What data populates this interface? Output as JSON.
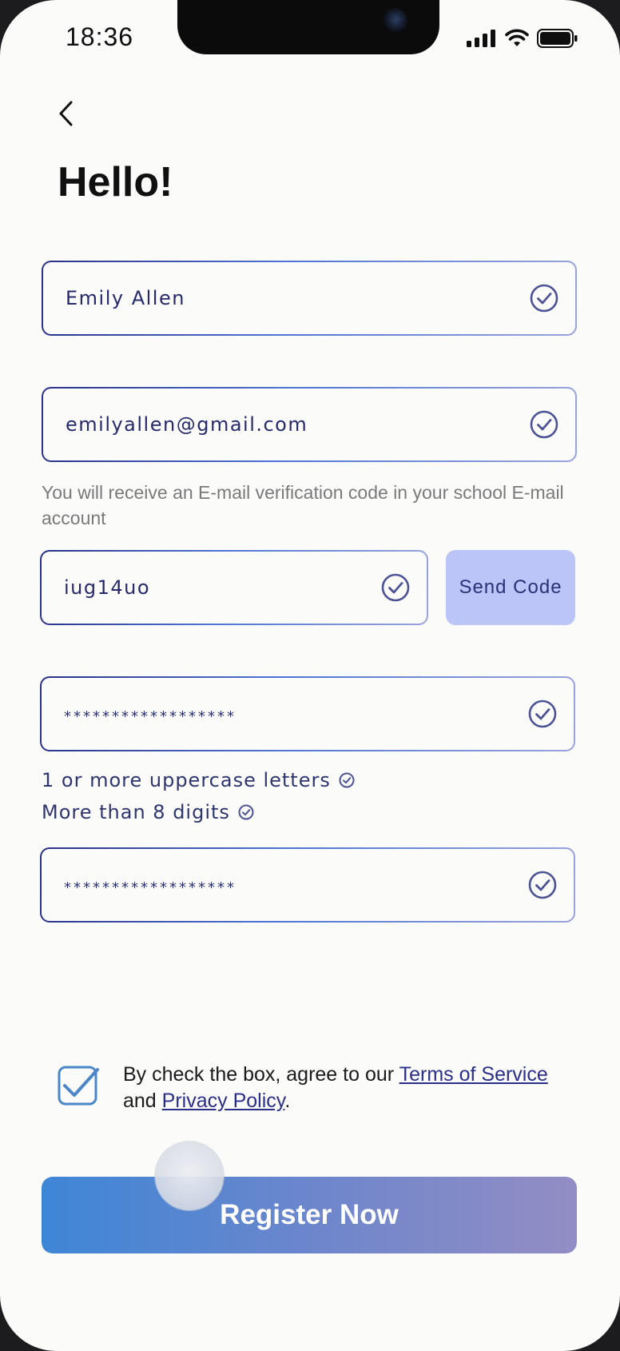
{
  "status": {
    "time": "18:36"
  },
  "header": {
    "title": "Hello!"
  },
  "form": {
    "name_value": "Emily Allen",
    "email_value": "emilyallen@gmail.com",
    "email_hint": "You will receive an E-mail verification code in your school E-mail account",
    "code_value": "iug14uo",
    "send_code_label": "Send Code",
    "password_value": "******************",
    "password_rules": [
      "1 or more uppercase letters",
      "More than 8 digits"
    ],
    "confirm_password_value": "******************"
  },
  "agreement": {
    "checked": true,
    "prefix": "By check the box, agree to our ",
    "terms_link": "Terms of Service",
    "middle": " and ",
    "privacy_link": "Privacy Policy",
    "suffix": "."
  },
  "register_label": "Register Now",
  "icons": {
    "back": "chevron-left-icon",
    "check": "check-circle-icon",
    "signal": "signal-icon",
    "wifi": "wifi-icon",
    "battery": "battery-icon"
  },
  "colors": {
    "field_border_start": "#2a2f8a",
    "field_border_end": "#9aa4dc",
    "send_code_bg": "#bcc5f8",
    "register_start": "#3d86d6",
    "register_end": "#938dc4",
    "check_icon": "#4c5394"
  }
}
